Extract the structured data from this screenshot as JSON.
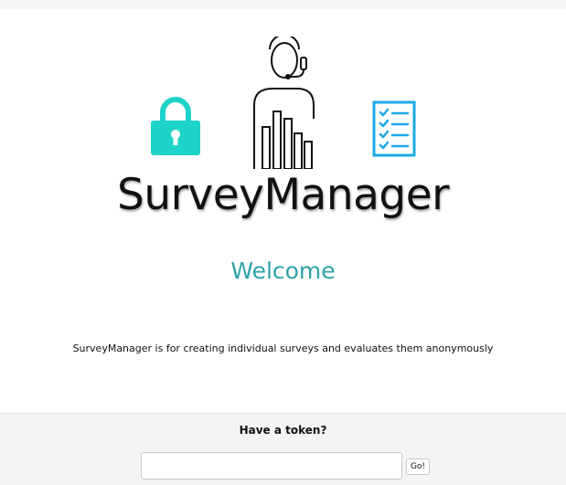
{
  "brand": {
    "title": "SurveyManager",
    "icons": [
      "lock-icon",
      "support-agent-chart-icon",
      "checklist-icon"
    ],
    "colors": {
      "lock": "#1ed3c9",
      "checklist": "#1ea8e6",
      "welcome": "#2fa3a7"
    }
  },
  "main": {
    "welcome": "Welcome",
    "description": "SurveyManager is for creating individual surveys and evaluates them anonymously"
  },
  "token": {
    "heading": "Have a token?",
    "input_value": "",
    "input_placeholder": "",
    "button_label": "Go!"
  }
}
